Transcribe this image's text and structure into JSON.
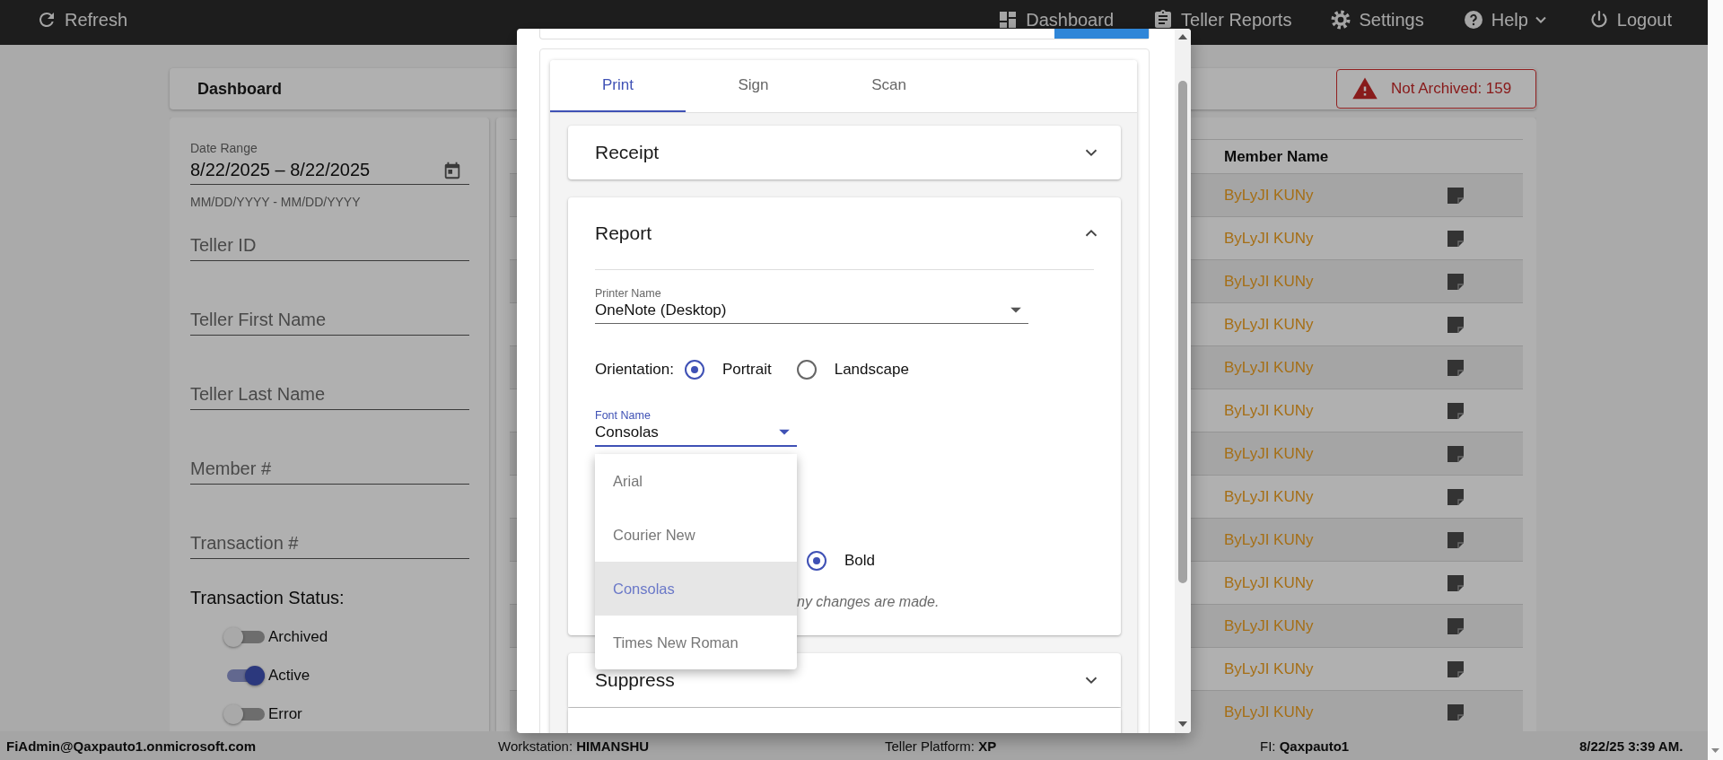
{
  "top_bar": {
    "left": [
      {
        "kind": "refresh",
        "label": "Refresh",
        "caret": false
      }
    ],
    "right": [
      {
        "kind": "dashboard",
        "label": "Dashboard",
        "caret": false
      },
      {
        "kind": "reports",
        "label": "Teller Reports",
        "caret": false
      },
      {
        "kind": "settings",
        "label": "Settings",
        "caret": false
      },
      {
        "kind": "help",
        "label": "Help",
        "caret": true
      },
      {
        "kind": "logout",
        "label": "Logout",
        "caret": false
      }
    ]
  },
  "header": {
    "title": "Dashboard",
    "alert": "Not Archived: 159"
  },
  "filters": {
    "date_range": {
      "label": "Date Range",
      "value": "8/22/2025 – 8/22/2025",
      "hint": "MM/DD/YYYY - MM/DD/YYYY"
    },
    "fields": [
      {
        "placeholder": "Teller ID"
      },
      {
        "placeholder": "Teller First Name"
      },
      {
        "placeholder": "Teller Last Name"
      },
      {
        "placeholder": "Member #"
      },
      {
        "placeholder": "Transaction #"
      }
    ],
    "status_title": "Transaction Status:",
    "statuses": [
      {
        "label": "Archived",
        "on": false
      },
      {
        "label": "Active",
        "on": true
      },
      {
        "label": "Error",
        "on": false
      }
    ]
  },
  "table": {
    "columns": [
      "Member Name"
    ],
    "rows": [
      {
        "member_name": "ByLyJI KUNy"
      },
      {
        "member_name": "ByLyJI KUNy"
      },
      {
        "member_name": "ByLyJI KUNy"
      },
      {
        "member_name": "ByLyJI KUNy"
      },
      {
        "member_name": "ByLyJI KUNy"
      },
      {
        "member_name": "ByLyJI KUNy"
      },
      {
        "member_name": "ByLyJI KUNy"
      },
      {
        "member_name": "ByLyJI KUNy"
      },
      {
        "member_name": "ByLyJI KUNy"
      },
      {
        "member_name": "ByLyJI KUNy"
      },
      {
        "member_name": "ByLyJI KUNy"
      },
      {
        "member_name": "ByLyJI KUNy"
      },
      {
        "member_name": "ByLyJI KUNy"
      }
    ]
  },
  "dialog": {
    "tabs": [
      {
        "label": "Print",
        "selected": true
      },
      {
        "label": "Sign",
        "selected": false
      },
      {
        "label": "Scan",
        "selected": false
      }
    ],
    "panels": [
      {
        "title": "Receipt",
        "expanded": false
      },
      {
        "title": "Report",
        "expanded": true
      },
      {
        "title": "Suppress",
        "expanded": false
      }
    ],
    "report": {
      "printer": {
        "label": "Printer Name",
        "value": "OneNote (Desktop)"
      },
      "orientation": {
        "label": "Orientation:",
        "options": [
          {
            "label": "Portrait",
            "selected": true
          },
          {
            "label": "Landscape",
            "selected": false
          }
        ]
      },
      "font_name": {
        "label": "Font Name",
        "value": "Consolas",
        "focused": true
      },
      "font_menu": [
        {
          "label": "Arial",
          "selected": false
        },
        {
          "label": "Courier New",
          "selected": false
        },
        {
          "label": "Consolas",
          "selected": true
        },
        {
          "label": "Times New Roman",
          "selected": false
        }
      ],
      "font_style": {
        "options": [
          {
            "label": "Bold",
            "selected": true
          }
        ]
      },
      "note": "ny changes are made."
    }
  },
  "status_bar": [
    {
      "kind": "account",
      "text": "FiAdmin@Qaxpauto1.onmicrosoft.com"
    },
    {
      "kind": "field",
      "text": "Workstation: **HIMANSHU**"
    },
    {
      "kind": "field",
      "text": "Teller Platform: **XP**"
    },
    {
      "kind": "field",
      "text": "FI: **Qaxpauto1**"
    },
    {
      "kind": "time",
      "text": "8/22/25 3:39 AM."
    }
  ]
}
